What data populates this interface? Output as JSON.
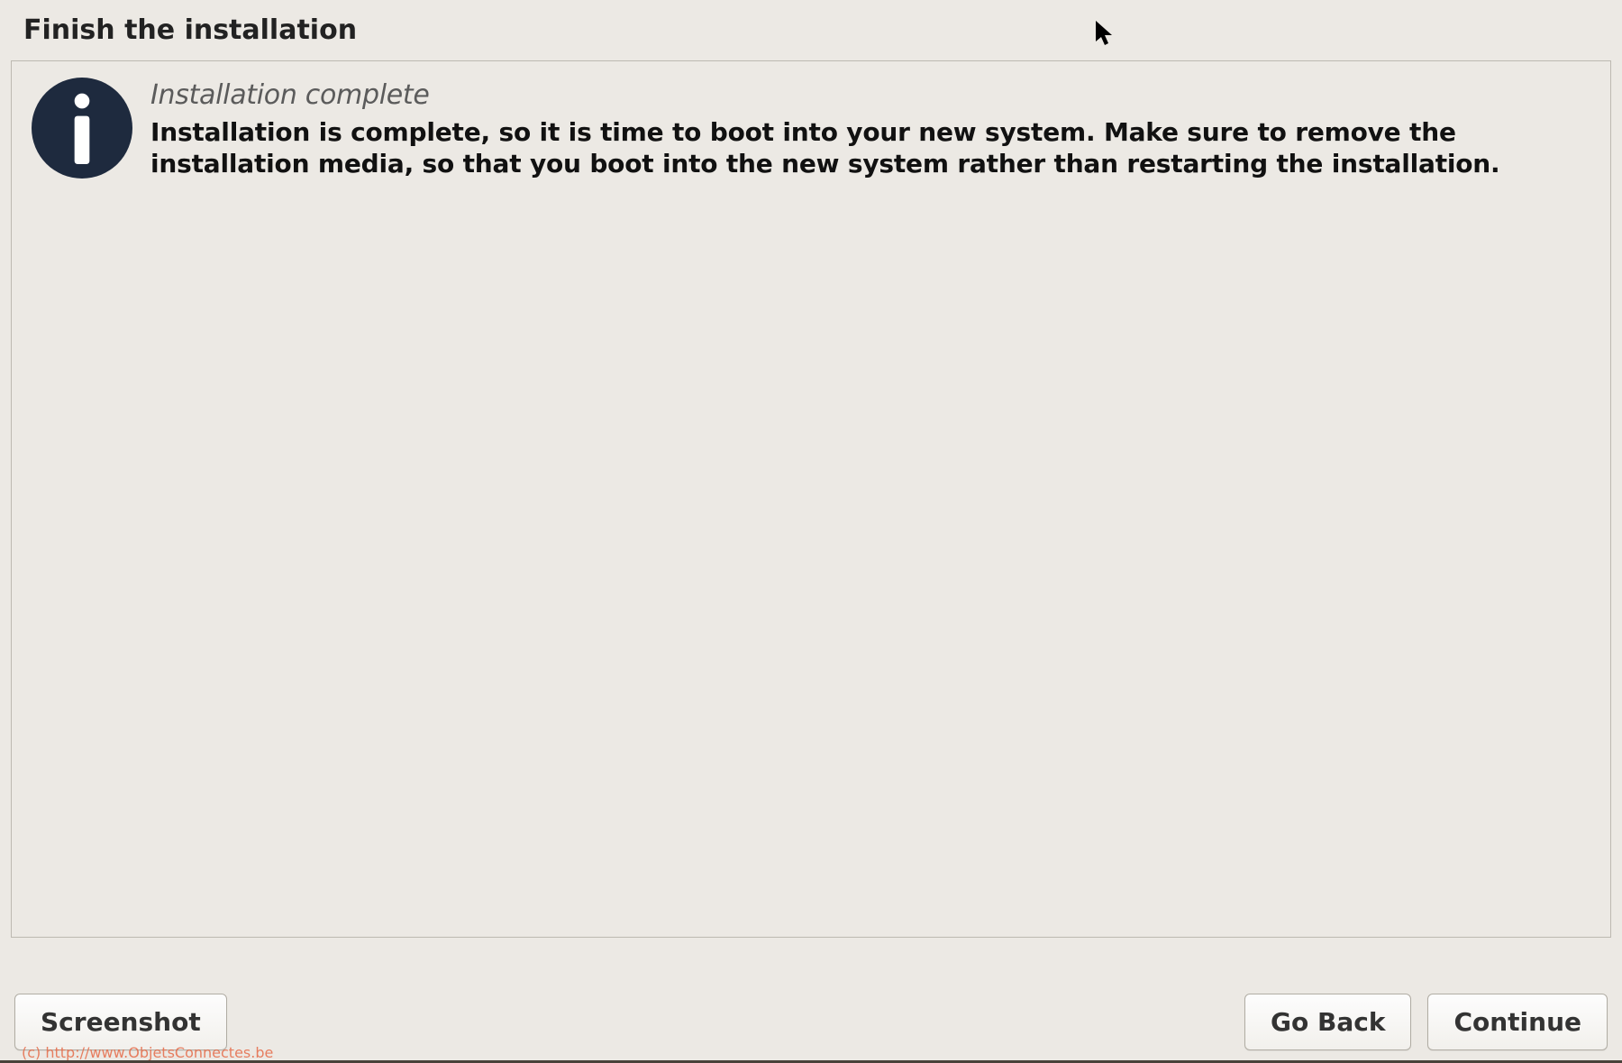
{
  "header": {
    "title": "Finish the installation"
  },
  "info": {
    "heading": "Installation complete",
    "body": "Installation is complete, so it is time to boot into your new system. Make sure to remove the installation media, so that you boot into the new system rather than restarting the installation.",
    "icon_name": "info-icon"
  },
  "buttons": {
    "screenshot": "Screenshot",
    "go_back": "Go Back",
    "continue": "Continue"
  },
  "watermark": "(c) http://www.ObjetsConnectes.be",
  "colors": {
    "background": "#ece9e4",
    "panel_border": "#bdb9b1",
    "icon_bg": "#1e2a3e",
    "watermark": "#e66b48"
  }
}
